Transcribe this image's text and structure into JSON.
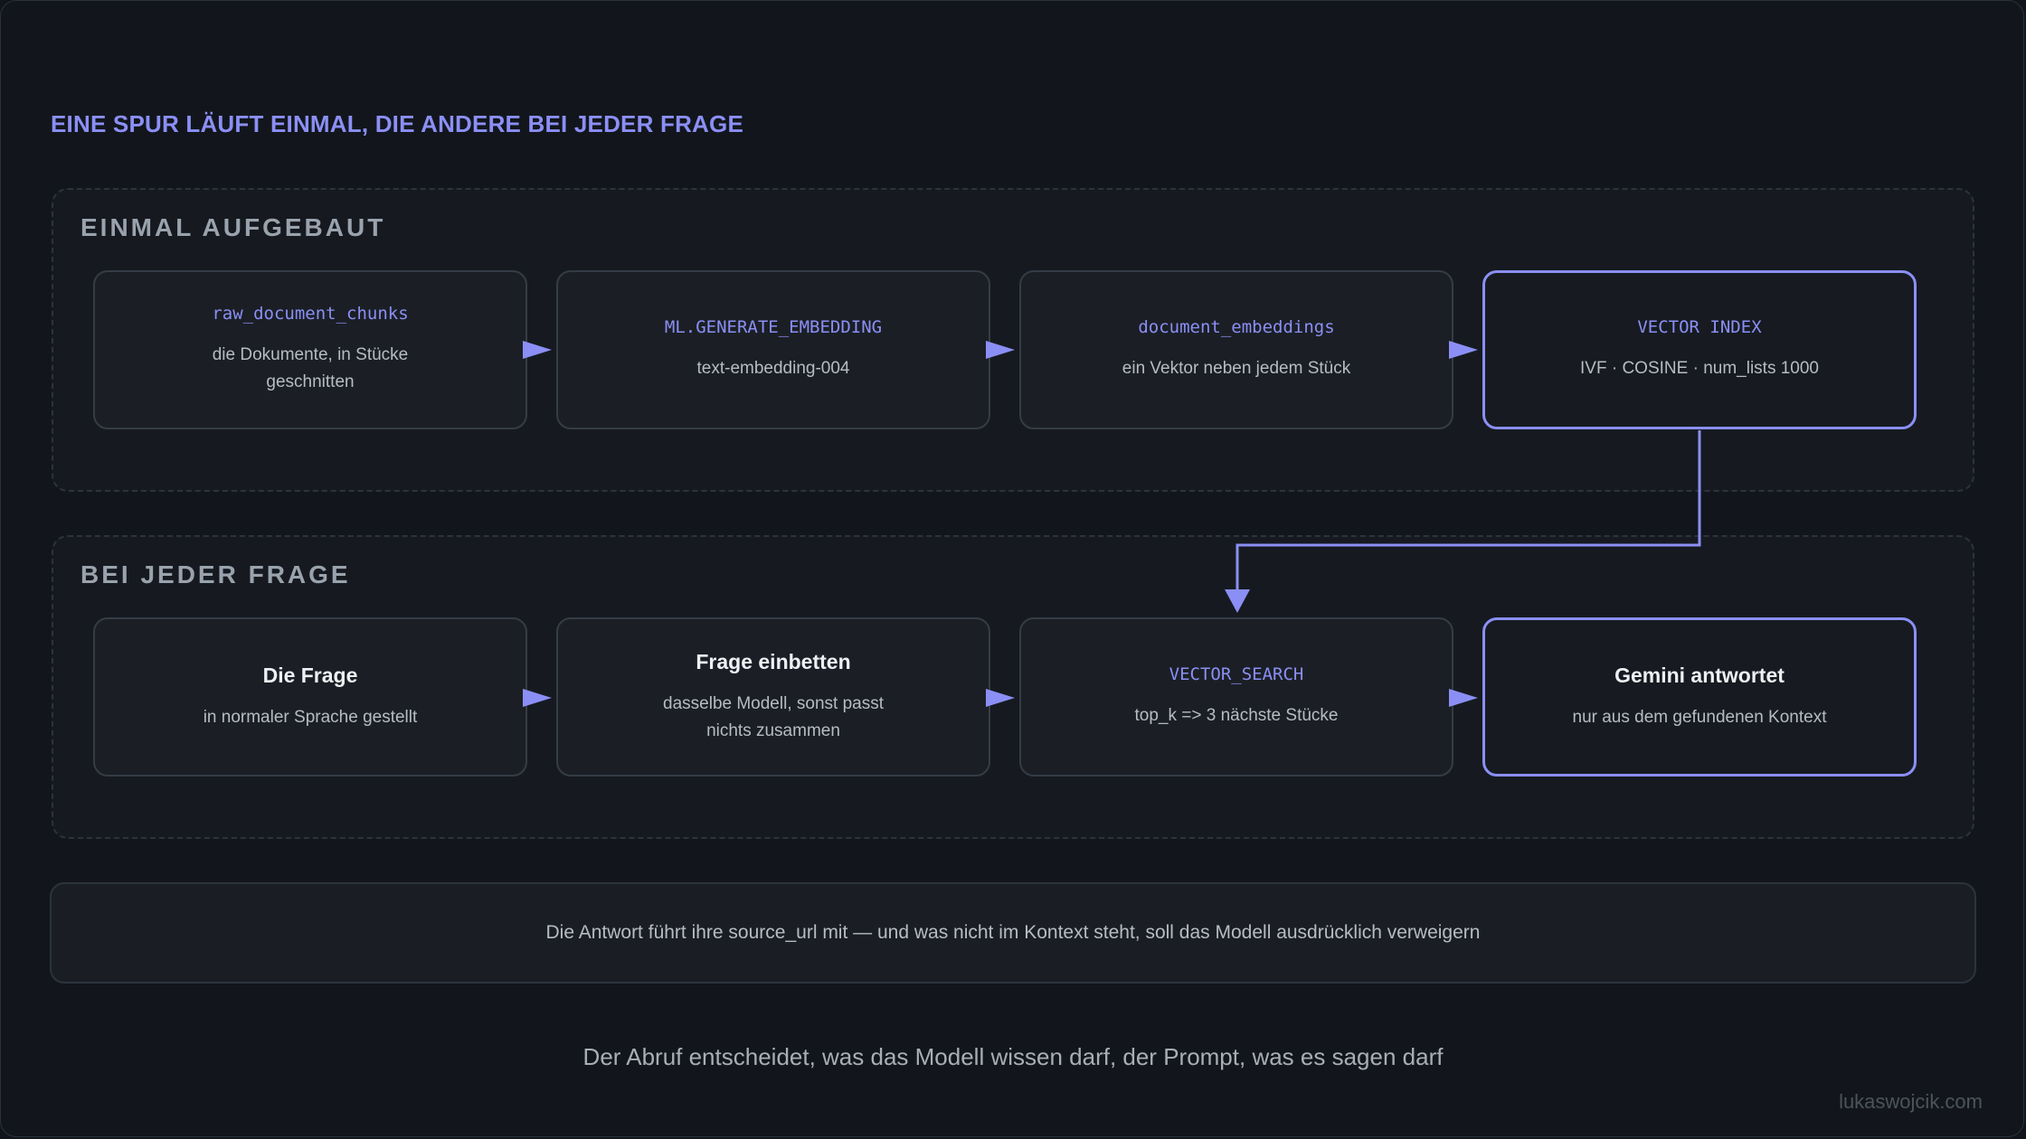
{
  "heading": "EINE SPUR LÄUFT EINMAL, DIE ANDERE BEI JEDER FRAGE",
  "lanes": [
    {
      "label": "EINMAL AUFGEBAUT",
      "steps": [
        {
          "title": "raw_document_chunks",
          "style": "mono",
          "subtitle": "die Dokumente, in Stücke geschnitten"
        },
        {
          "title": "ML.GENERATE_EMBEDDING",
          "style": "mono",
          "subtitle": "text-embedding-004"
        },
        {
          "title": "document_embeddings",
          "style": "mono",
          "subtitle": "ein Vektor neben jedem Stück"
        },
        {
          "title": "VECTOR INDEX",
          "style": "mono",
          "subtitle": "IVF · COSINE · num_lists 1000"
        }
      ]
    },
    {
      "label": "BEI JEDER FRAGE",
      "steps": [
        {
          "title": "Die Frage",
          "style": "bold",
          "subtitle": "in normaler Sprache gestellt"
        },
        {
          "title": "Frage einbetten",
          "style": "bold",
          "subtitle": "dasselbe Modell, sonst passt nichts zusammen"
        },
        {
          "title": "VECTOR_SEARCH",
          "style": "mono",
          "subtitle": "top_k => 3 nächste Stücke"
        },
        {
          "title": "Gemini antwortet",
          "style": "bold",
          "subtitle": "nur aus dem gefundenen Kontext"
        }
      ]
    }
  ],
  "note": "Die Antwort führt ihre source_url mit — und was nicht im Kontext steht, soll das Modell ausdrücklich verweigern",
  "footer": "Der Abruf entscheidet, was das Modell wissen darf, der Prompt, was es sagen darf",
  "credit": "lukaswojcik.com",
  "colors": {
    "accent": "#8b8ff5",
    "background": "#12161c",
    "box": "#1b1f25"
  }
}
